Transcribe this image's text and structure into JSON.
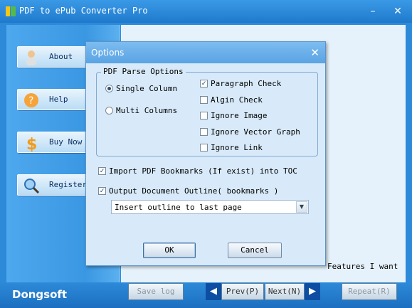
{
  "app": {
    "title": "PDF to ePub Converter Pro",
    "brand": "Dongsoft"
  },
  "window_controls": {
    "minimize": "–",
    "close": "✕"
  },
  "sidebar": {
    "items": [
      {
        "label": "About",
        "icon": "person-icon"
      },
      {
        "label": "Help",
        "icon": "help-icon"
      },
      {
        "label": "Buy Now",
        "icon": "dollar-icon"
      },
      {
        "label": "Register",
        "icon": "magnifier-icon"
      }
    ]
  },
  "bottom": {
    "save_log": "Save log",
    "prev": "Prev(P)",
    "next": "Next(N)",
    "repeat": "Repeat(R)",
    "features": "Features I want"
  },
  "dialog": {
    "title": "Options",
    "close": "✕",
    "group_title": "PDF Parse Options",
    "single_columns": "Single Column",
    "multi_columns": "Multi Columns",
    "paragraph_check": "Paragraph Check",
    "align_check": "Algin Check",
    "ignore_image": "Ignore Image",
    "ignore_vector": "Ignore Vector Graph",
    "ignore_link": "Ignore Link",
    "import_bookmarks": "Import PDF Bookmarks (If exist) into TOC",
    "output_outline": "Output Document Outline( bookmarks )",
    "outline_select_value": "Insert outline to last page",
    "ok": "OK",
    "cancel": "Cancel"
  },
  "colors": {
    "accent": "#2d8ad8",
    "dialog_bg": "#d8eaf9"
  }
}
